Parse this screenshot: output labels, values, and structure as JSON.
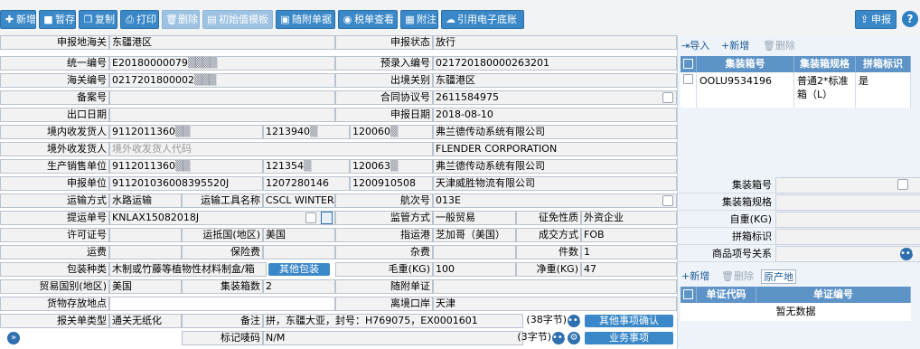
{
  "toolbar": {
    "buttons": [
      {
        "label": "新增",
        "icon": "plus-icon"
      },
      {
        "label": "暂存",
        "icon": "save-icon"
      },
      {
        "label": "复制",
        "icon": "copy-icon"
      },
      {
        "label": "打印",
        "icon": "print-icon"
      },
      {
        "label": "删除",
        "icon": "trash-icon"
      },
      {
        "label": "初始值模板",
        "icon": "template-icon"
      },
      {
        "label": "随附单据",
        "icon": "document-icon"
      },
      {
        "label": "税单查看",
        "icon": "eye-icon"
      },
      {
        "label": "附注",
        "icon": "note-icon"
      },
      {
        "label": "引用电子底账",
        "icon": "cloud-icon"
      }
    ],
    "declare_label": "申报",
    "help_label": "?"
  },
  "form": {
    "customs_label": "申报地海关",
    "customs_value": "东疆港区",
    "status_label": "申报状态",
    "status_value": "放行",
    "unified_no_label": "统一编号",
    "unified_no_value": "E20180000079",
    "preentry_label": "预录入编号",
    "preentry_value": "021720180000263201",
    "customs_no_label": "海关编号",
    "customs_no_value": "0217201800002",
    "exit_customs_label": "出境关别",
    "exit_customs_value": "东疆港区",
    "record_label": "备案号",
    "record_value": "",
    "contract_label": "合同协议号",
    "contract_value": "2611584975",
    "export_date_label": "出口日期",
    "export_date_value": "",
    "declare_date_label": "申报日期",
    "declare_date_value": "2018-08-10",
    "domestic_consignor_label": "境内收发货人",
    "domestic_consignor_code": "9112011360",
    "domestic_consignor_code2": "1213940",
    "domestic_consignor_code3": "120060",
    "domestic_consignor_name": "弗兰德传动系统有限公司",
    "foreign_consignor_label": "境外收发货人",
    "foreign_consignor_placeholder": "境外收发货人代码",
    "foreign_consignor_name": "FLENDER CORPORATION",
    "producer_label": "生产销售单位",
    "producer_code": "9112011360",
    "producer_code2": "121354",
    "producer_code3": "120063",
    "producer_name": "弗兰德传动系统有限公司",
    "declarant_label": "申报单位",
    "declarant_code": "911201036008395520J",
    "declarant_code2": "1207280146",
    "declarant_code3": "1200910508",
    "declarant_name": "天津威胜物流有限公司",
    "transport_mode_label": "运输方式",
    "transport_mode_value": "水路运输",
    "transport_tool_label": "运输工具名称",
    "transport_tool_value": "CSCL WINTER",
    "voyage_label": "航次号",
    "voyage_value": "013E",
    "bill_label": "提运单号",
    "bill_value": "KNLAX15082018J",
    "supervision_label": "监管方式",
    "supervision_value": "一般贸易",
    "tax_nature_label": "征免性质",
    "tax_nature_value": "外资企业",
    "license_label": "许可证号",
    "license_value": "",
    "arrival_country_label": "运抵国(地区)",
    "arrival_country_value": "美国",
    "dest_port_label": "指运港",
    "dest_port_value": "芝加哥（美国）",
    "deal_mode_label": "成交方式",
    "deal_mode_value": "FOB",
    "freight_label": "运费",
    "freight_value": "",
    "insurance_label": "保险费",
    "insurance_value": "",
    "misc_label": "杂费",
    "misc_value": "",
    "pieces_label": "件数",
    "pieces_value": "1",
    "package_label": "包装种类",
    "package_value": "木制或竹藤等植物性材料制盒/箱",
    "other_package_btn": "其他包装",
    "gross_label": "毛重(KG)",
    "gross_value": "100",
    "net_label": "净重(KG)",
    "net_value": "47",
    "trade_country_label": "贸易国别(地区)",
    "trade_country_value": "美国",
    "container_count_label": "集装箱数",
    "container_count_value": "2",
    "attached_doc_label": "随附单证",
    "attached_doc_value": "",
    "goods_location_label": "货物存放地点",
    "goods_location_value": "",
    "departure_port_label": "离境口岸",
    "departure_port_value": "天津",
    "form_type_label": "报关单类型",
    "form_type_value": "通关无纸化",
    "remark_label": "备注",
    "remark_value": "拼，东疆大亚，封号：H769075，EX0001601",
    "remark_count": "(38字节)",
    "other_confirm_btn": "其他事项确认",
    "mark_label": "标记唛码",
    "mark_value": "N/M",
    "mark_count": "(3字节)",
    "business_btn": "业务事项",
    "expand_icon": "»"
  },
  "container_panel": {
    "toolbar": {
      "import_label": "导入",
      "add_label": "新增",
      "delete_label": "删除"
    },
    "columns": [
      "集装箱号",
      "集装箱规格",
      "拼箱标识"
    ],
    "rows": [
      {
        "no": "OOLU9534196",
        "spec": "普通2*标准箱（L）",
        "lcl": "是"
      }
    ],
    "field_container_no": "集装箱号",
    "field_container_spec": "集装箱规格",
    "field_tare": "自重(KG)",
    "field_lcl": "拼箱标识",
    "field_item_relation": "商品项号关系"
  },
  "doc_panel": {
    "toolbar": {
      "add_label": "新增",
      "delete_label": "删除",
      "origin_label": "原产地"
    },
    "columns": [
      "单证代码",
      "单证编号"
    ],
    "empty_text": "暂无数据"
  }
}
